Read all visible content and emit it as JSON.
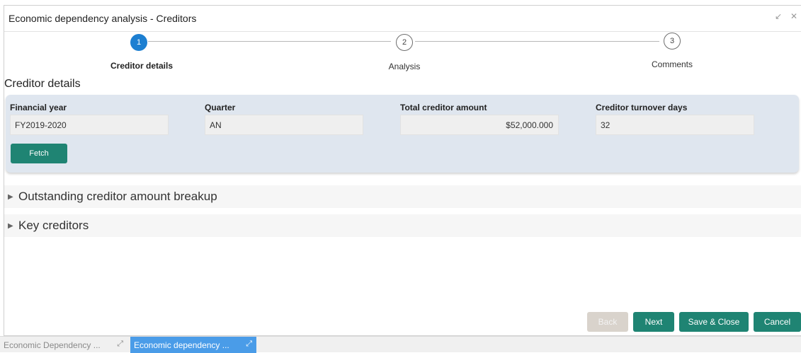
{
  "window": {
    "title": "Economic dependency analysis - Creditors",
    "minimize_icon": "↙",
    "close_icon": "✕"
  },
  "steps": [
    {
      "number": "1",
      "label": "Creditor details",
      "state": "active"
    },
    {
      "number": "2",
      "label": "Analysis",
      "state": "inactive"
    },
    {
      "number": "3",
      "label": "Comments",
      "state": "inactive"
    }
  ],
  "section_title": "Creditor details",
  "fields": {
    "financial_year": {
      "label": "Financial year",
      "value": "FY2019-2020"
    },
    "quarter": {
      "label": "Quarter",
      "value": "AN"
    },
    "total_creditor_amount": {
      "label": "Total creditor amount",
      "value": "$52,000.000"
    },
    "creditor_turnover_days": {
      "label": "Creditor turnover days",
      "value": "32"
    }
  },
  "fetch_label": "Fetch",
  "collapsibles": [
    {
      "label": "Outstanding creditor amount breakup",
      "icon": "caret-right-icon"
    },
    {
      "label": "Key creditors",
      "icon": "caret-right-icon"
    }
  ],
  "footer": {
    "back": "Back",
    "next": "Next",
    "save_close": "Save & Close",
    "cancel": "Cancel"
  },
  "taskbar": [
    {
      "label": "Economic Dependency ...",
      "state": "inactive"
    },
    {
      "label": "Economic dependency ...",
      "state": "active"
    }
  ],
  "colors": {
    "accent": "#1d7fd1",
    "primary_button": "#1f8473",
    "card_bg": "#dfe6ef",
    "active_task": "#4a9ce8"
  }
}
